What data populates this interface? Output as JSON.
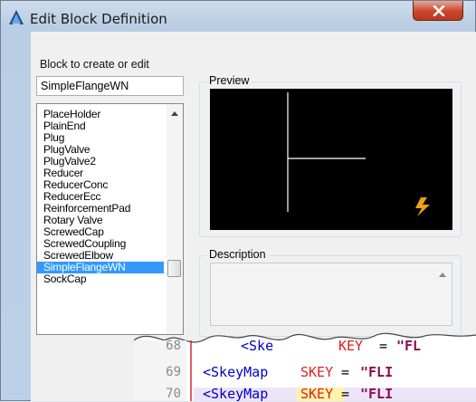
{
  "window": {
    "title": "Edit Block Definition",
    "close_symbol": "X"
  },
  "form": {
    "block_label": "Block to create or edit",
    "block_value": "SimpleFlangeWN",
    "preview_label": "Preview",
    "description_label": "Description"
  },
  "list": {
    "items": [
      "PlaceHolder",
      "PlainEnd",
      "Plug",
      "PlugValve",
      "PlugValve2",
      "Reducer",
      "ReducerConc",
      "ReducerEcc",
      "ReinforcementPad",
      "Rotary Valve",
      "ScrewedCap",
      "ScrewedCoupling",
      "ScrewedElbow",
      "SimpleFlangeWN",
      "SockCap"
    ],
    "selected": "SimpleFlangeWN"
  },
  "code": {
    "lines": [
      {
        "num": "68",
        "tag": "<Ske",
        "attr": "KEY",
        "eq": " = ",
        "val": "\"FL"
      },
      {
        "num": "69",
        "tag": "<SkeyMap",
        "attr": "SKEY",
        "eq": " = ",
        "val": "\"FLI"
      },
      {
        "num": "70",
        "tag": "<SkeyMap",
        "attr": "SKEY",
        "eq": " = ",
        "val": "\"FLI"
      }
    ]
  },
  "colors": {
    "accent": "#3399ff",
    "preview_bg": "#000000",
    "bolt_icon": "#e8a317"
  },
  "icons": {
    "app": "autocad-a-icon",
    "bolt": "lightning-bolt-icon"
  }
}
